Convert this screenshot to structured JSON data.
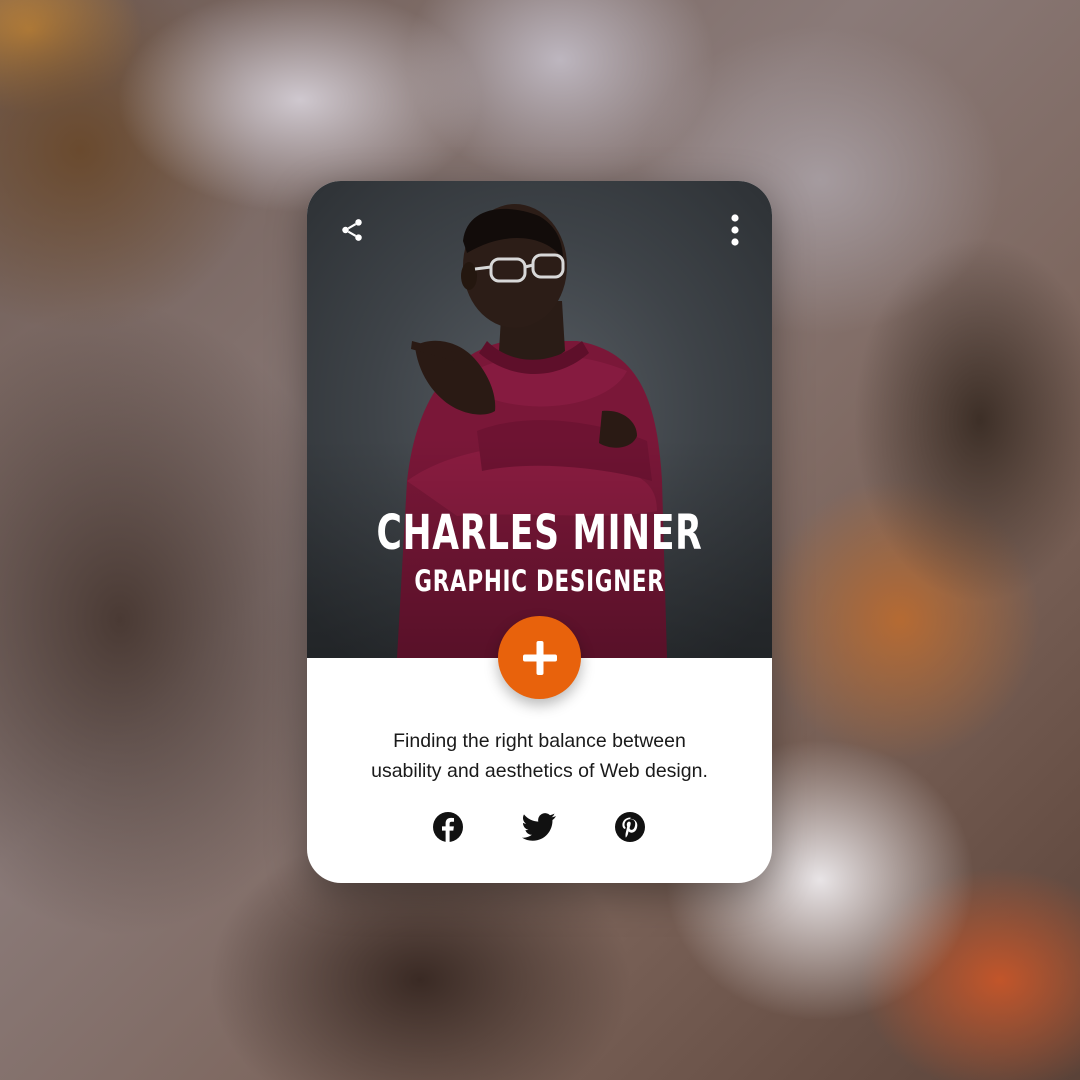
{
  "profile": {
    "name": "CHARLES MINER",
    "role": "GRAPHIC DESIGNER",
    "bio_line1": "Finding the right balance between",
    "bio_line2": "usability and aesthetics of Web design."
  },
  "actions": {
    "share_icon": "share-icon",
    "more_icon": "more-vertical-icon",
    "add_icon": "plus-icon"
  },
  "socials": [
    {
      "name": "facebook",
      "icon": "facebook-icon"
    },
    {
      "name": "twitter",
      "icon": "twitter-icon"
    },
    {
      "name": "pinterest",
      "icon": "pinterest-icon"
    }
  ],
  "colors": {
    "accent": "#e8620c",
    "card_bg": "#ffffff",
    "text_dark": "#1a1a1a"
  }
}
